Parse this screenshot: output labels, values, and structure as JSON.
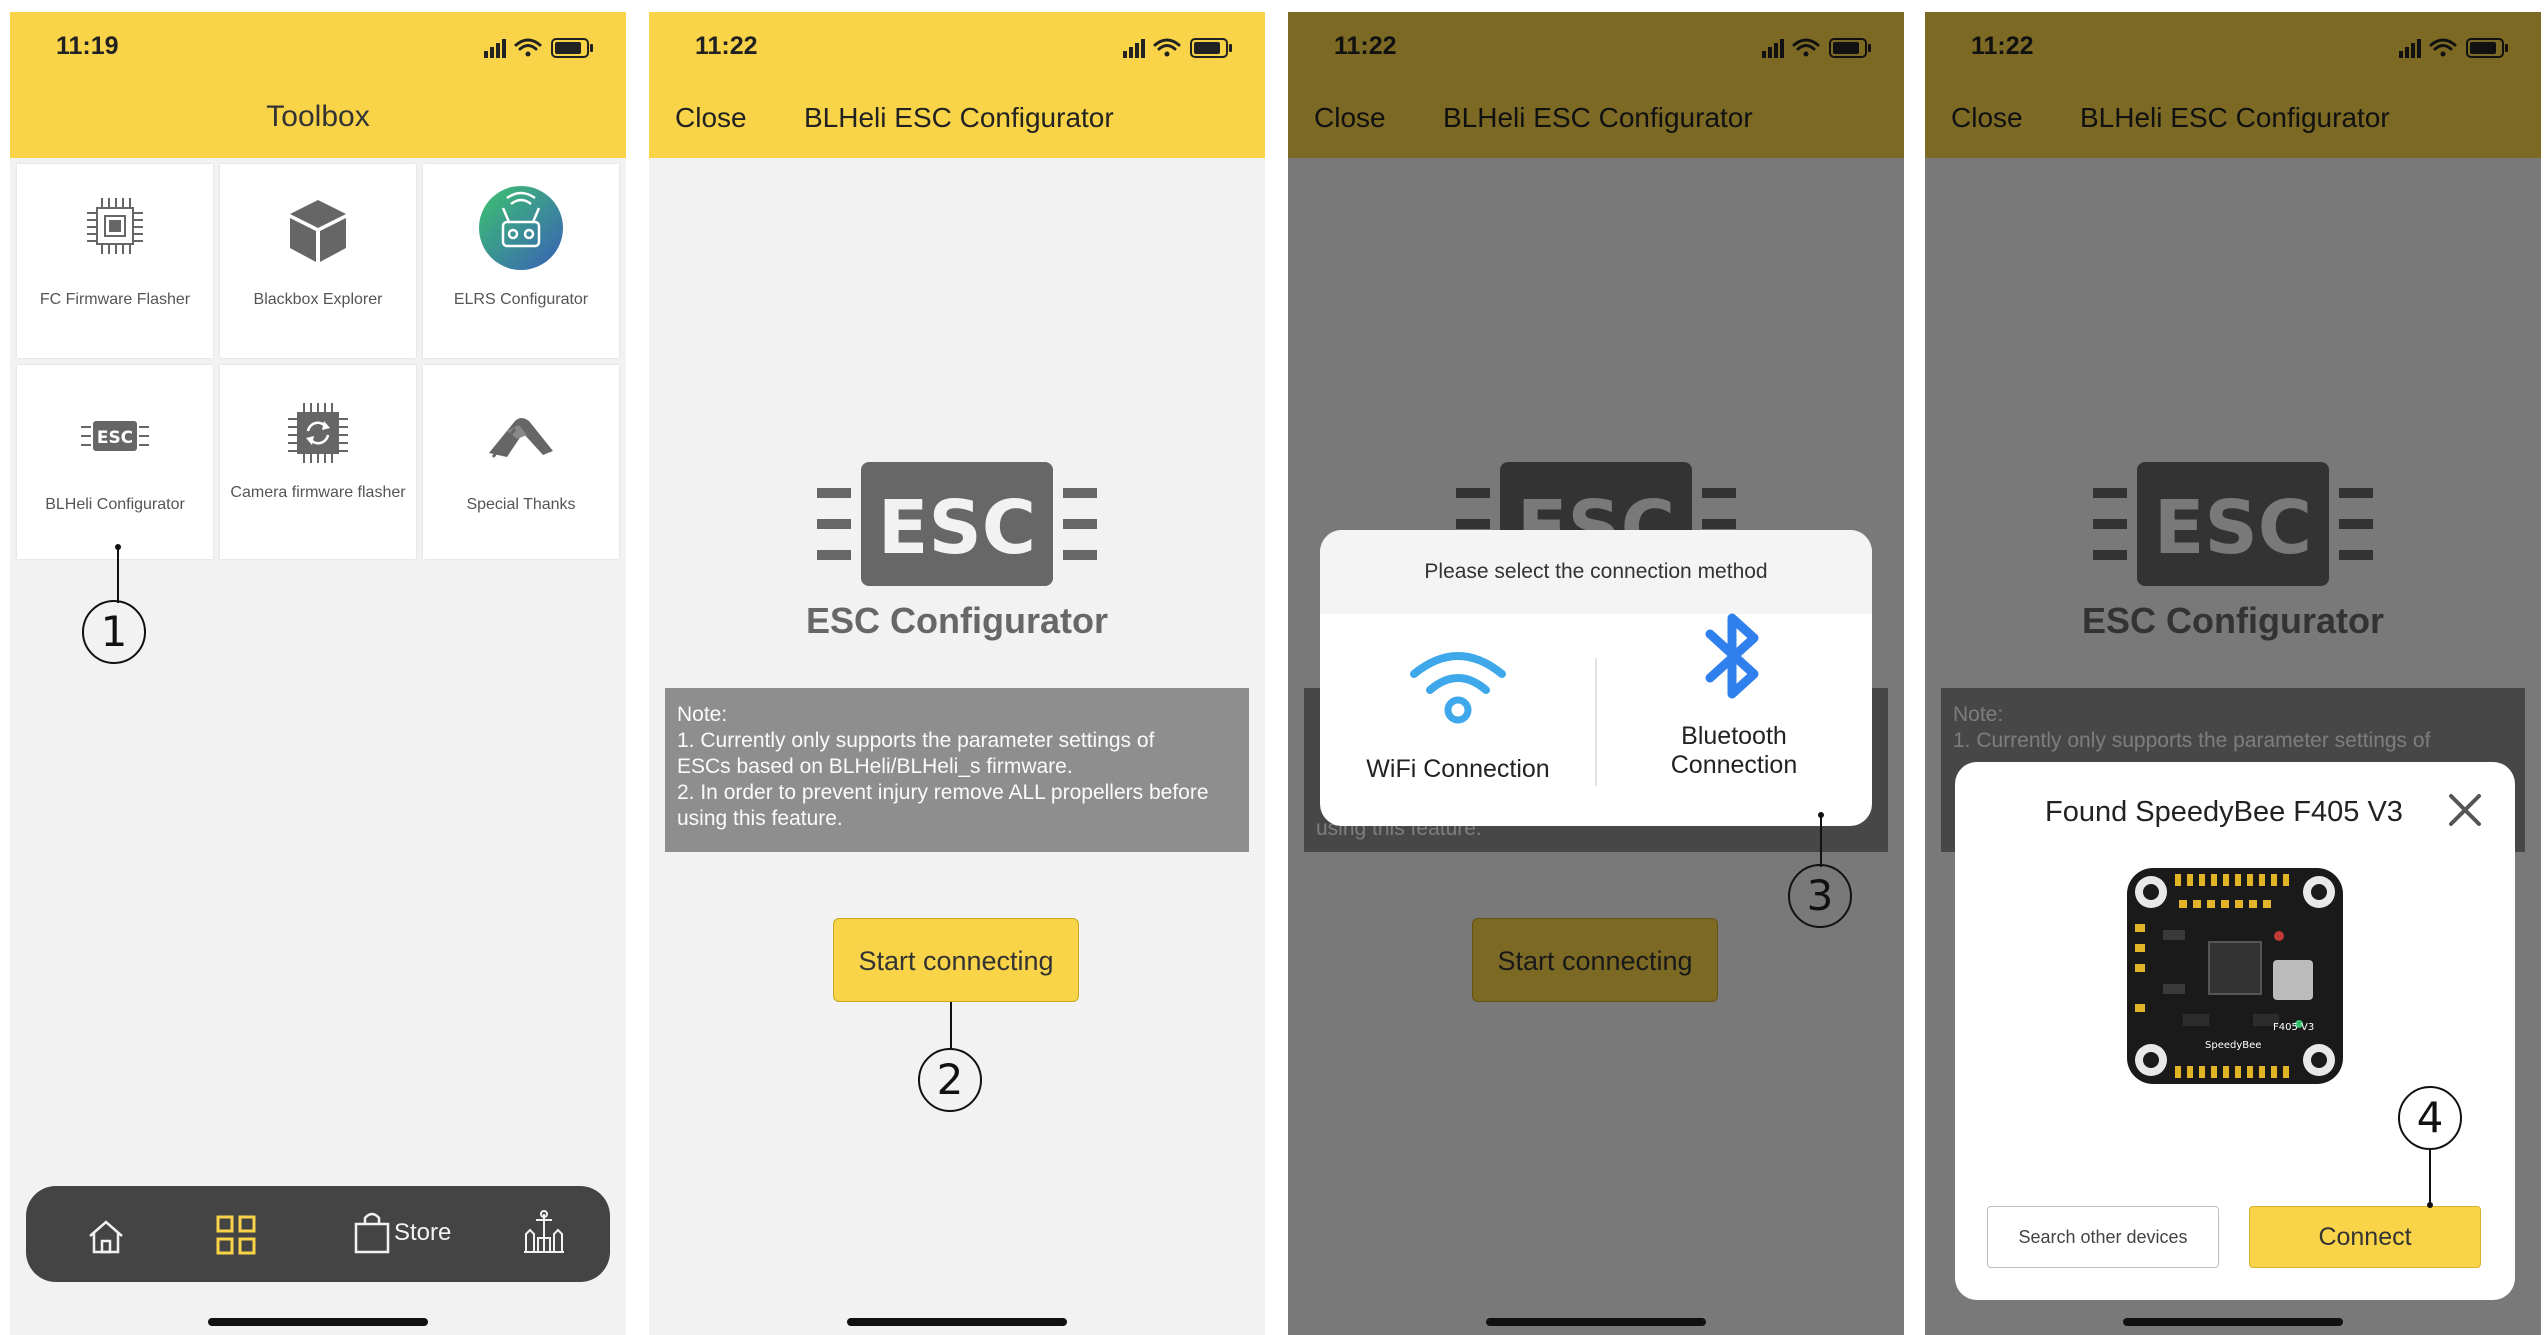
{
  "screen1": {
    "time": "11:19",
    "title": "Toolbox",
    "tiles": [
      {
        "label": "FC Firmware Flasher",
        "icon": "chip-icon"
      },
      {
        "label": "Blackbox Explorer",
        "icon": "cube-icon"
      },
      {
        "label": "ELRS Configurator",
        "icon": "elrs-icon"
      },
      {
        "label": "BLHeli Configurator",
        "icon": "esc-icon"
      },
      {
        "label": "Camera firmware flasher",
        "icon": "chip-refresh-icon"
      },
      {
        "label": "Special Thanks",
        "icon": "handshake-icon"
      }
    ],
    "tabbar": {
      "store_label": "Store"
    }
  },
  "screen2": {
    "time": "11:22",
    "close_label": "Close",
    "nav_title": "BLHeli ESC Configurator",
    "logo_text": "ESC",
    "esc_title": "ESC Configurator",
    "note": {
      "heading": "Note:",
      "line1": "1. Currently only supports the parameter settings of",
      "line2": "ESCs based on BLHeli/BLHeli_s firmware.",
      "line3": "2. In order to prevent injury remove ALL propellers before",
      "line4": "using this feature."
    },
    "start_label": "Start connecting"
  },
  "screen3": {
    "time": "11:22",
    "close_label": "Close",
    "nav_title": "BLHeli ESC Configurator",
    "logo_text": "ESC",
    "start_label": "Start connecting",
    "note_tail": "using this feature.",
    "dialog": {
      "title": "Please select the connection method",
      "wifi_label": "WiFi Connection",
      "bt_line1": "Bluetooth",
      "bt_line2": "Connection"
    }
  },
  "screen4": {
    "time": "11:22",
    "close_label": "Close",
    "nav_title": "BLHeli ESC Configurator",
    "logo_text": "ESC",
    "esc_title": "ESC Configurator",
    "note_heading": "Note:",
    "note_line1": "1. Currently only supports the parameter settings of",
    "dialog": {
      "title": "Found SpeedyBee F405 V3",
      "board_model": "F405 V3",
      "board_brand": "SpeedyBee",
      "search_label": "Search other devices",
      "connect_label": "Connect"
    }
  },
  "callouts": [
    "1",
    "2",
    "3",
    "4"
  ],
  "colors": {
    "accent_yellow": "#f9d448",
    "dark_tab": "#444444",
    "logo_gray": "#676767",
    "bluetooth_blue": "#2f80ed",
    "wifi_blue": "#3ea8ea"
  }
}
